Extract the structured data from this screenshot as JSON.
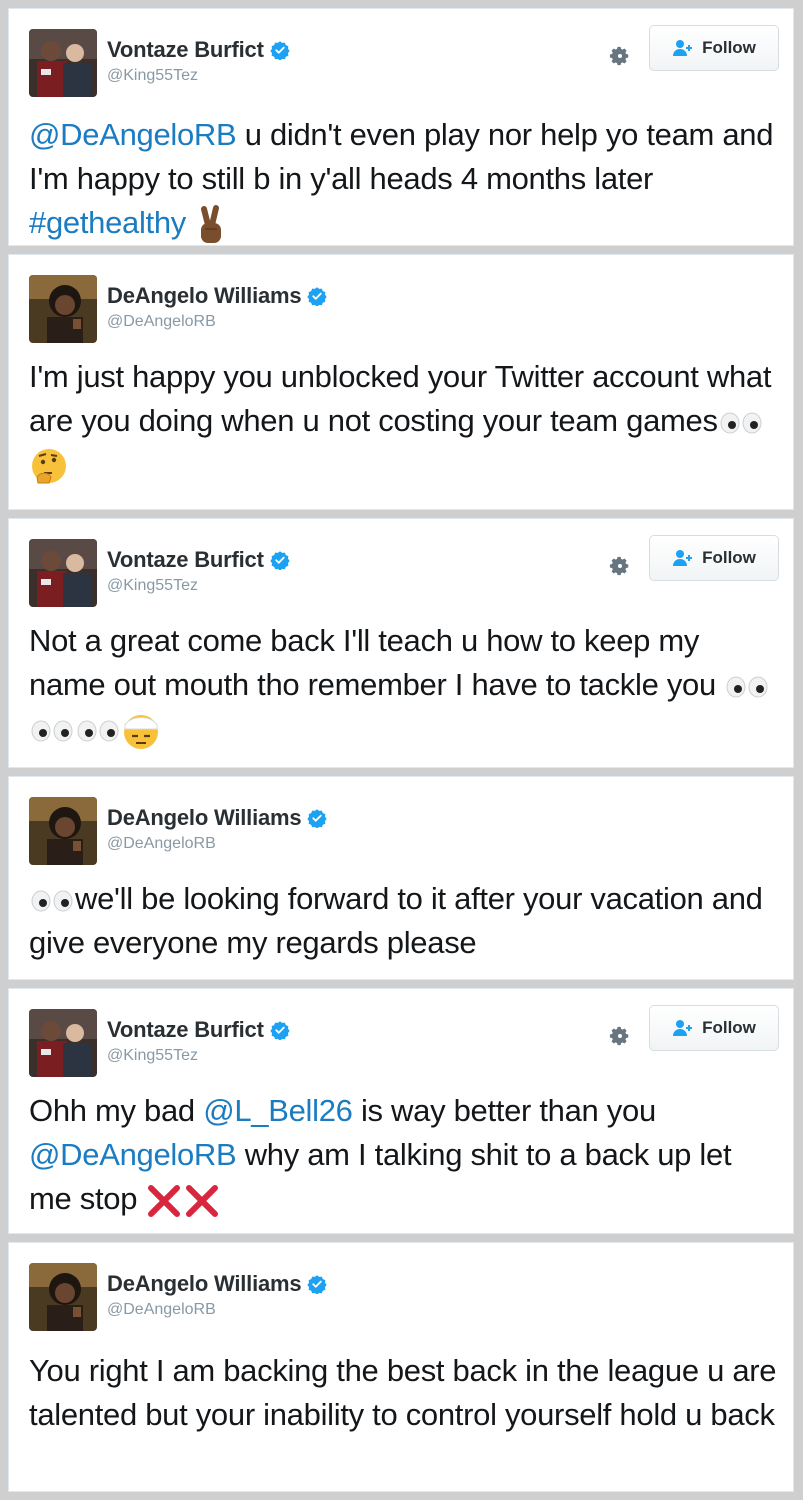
{
  "follow_label": "Follow",
  "colors": {
    "link": "#1b7cc1",
    "verified": "#1da1f2",
    "handle": "#8899a6"
  },
  "tweets": [
    {
      "name": "Vontaze Burfict",
      "handle": "@King55Tez",
      "has_follow": true,
      "parts": [
        {
          "t": "@DeAngeloRB",
          "link": true
        },
        {
          "t": " u didn't even play nor help yo team and I'm happy to still b in y'all heads 4 months later "
        },
        {
          "t": "#gethealthy",
          "link": true
        },
        {
          "t": " "
        }
      ],
      "emoji": [
        "victory-hand-emoji"
      ]
    },
    {
      "name": "DeAngelo Williams",
      "handle": "@DeAngeloRB",
      "has_follow": false,
      "parts": [
        {
          "t": "I'm just happy you unblocked your Twitter account what are you doing when u not costing your team games"
        }
      ],
      "emoji": [
        "eyes-emoji",
        "thinking-face-emoji"
      ]
    },
    {
      "name": "Vontaze Burfict",
      "handle": "@King55Tez",
      "has_follow": true,
      "parts": [
        {
          "t": "Not a great come back I'll teach u how to keep my name out mouth tho remember I have to tackle you "
        }
      ],
      "emoji": [
        "eyes-emoji",
        "eyes-emoji",
        "eyes-emoji",
        "face-with-head-bandage-emoji"
      ]
    },
    {
      "name": "DeAngelo Williams",
      "handle": "@DeAngeloRB",
      "has_follow": false,
      "lead_emoji": [
        "eyes-emoji"
      ],
      "parts": [
        {
          "t": "we'll be looking forward to it after your vacation and give everyone my regards please"
        }
      ],
      "emoji": []
    },
    {
      "name": "Vontaze Burfict",
      "handle": "@King55Tez",
      "has_follow": true,
      "parts": [
        {
          "t": "Ohh my bad "
        },
        {
          "t": "@L_Bell26",
          "link": true
        },
        {
          "t": " is way better than you "
        },
        {
          "t": "@DeAngeloRB",
          "link": true
        },
        {
          "t": " why am I talking shit to a back up let me stop "
        }
      ],
      "emoji": [
        "cross-mark-emoji",
        "cross-mark-emoji"
      ]
    },
    {
      "name": "DeAngelo Williams",
      "handle": "@DeAngeloRB",
      "has_follow": false,
      "parts": [
        {
          "t": "You right I am backing the best back in the league u are talented but your inability to control yourself hold u back"
        }
      ],
      "emoji": []
    }
  ]
}
